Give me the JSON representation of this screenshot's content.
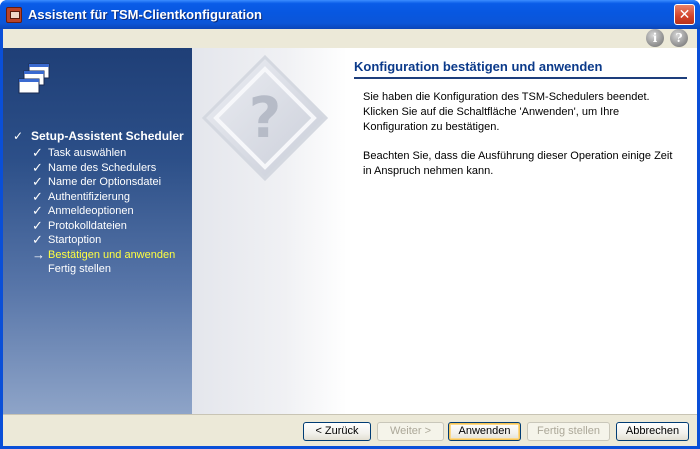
{
  "window": {
    "title": "Assistent für TSM-Clientkonfiguration",
    "close_label": "✕"
  },
  "help": {
    "info_label": "i",
    "question_label": "?"
  },
  "sidebar": {
    "main_step": "Setup-Assistent Scheduler",
    "steps": [
      {
        "label": "Task auswählen",
        "state": "done"
      },
      {
        "label": "Name des Schedulers",
        "state": "done"
      },
      {
        "label": "Name der Optionsdatei",
        "state": "done"
      },
      {
        "label": "Authentifizierung",
        "state": "done"
      },
      {
        "label": "Anmeldeoptionen",
        "state": "done"
      },
      {
        "label": "Protokolldateien",
        "state": "done"
      },
      {
        "label": "Startoption",
        "state": "done"
      },
      {
        "label": "Bestätigen und anwenden",
        "state": "current"
      },
      {
        "label": "Fertig stellen",
        "state": "pending"
      }
    ],
    "check_glyph": "✓",
    "arrow_glyph": "→"
  },
  "content": {
    "heading": "Konfiguration bestätigen und anwenden",
    "paragraph1": "Sie haben die Konfiguration des TSM-Schedulers beendet. Klicken Sie auf die Schaltfläche 'Anwenden', um Ihre Konfiguration zu bestätigen.",
    "paragraph2": "Beachten Sie, dass die Ausführung dieser Operation einige Zeit in Anspruch nehmen kann.",
    "watermark_glyph": "?"
  },
  "buttons": {
    "back": "< Zurück",
    "next": "Weiter >",
    "apply": "Anwenden",
    "finish": "Fertig stellen",
    "cancel": "Abbrechen"
  },
  "colors": {
    "titlebar": "#0857e0",
    "sidebar_top": "#1f3f77",
    "sidebar_bottom": "#8ea4c8",
    "current_step": "#ffff40",
    "heading": "#0b3a8a"
  }
}
